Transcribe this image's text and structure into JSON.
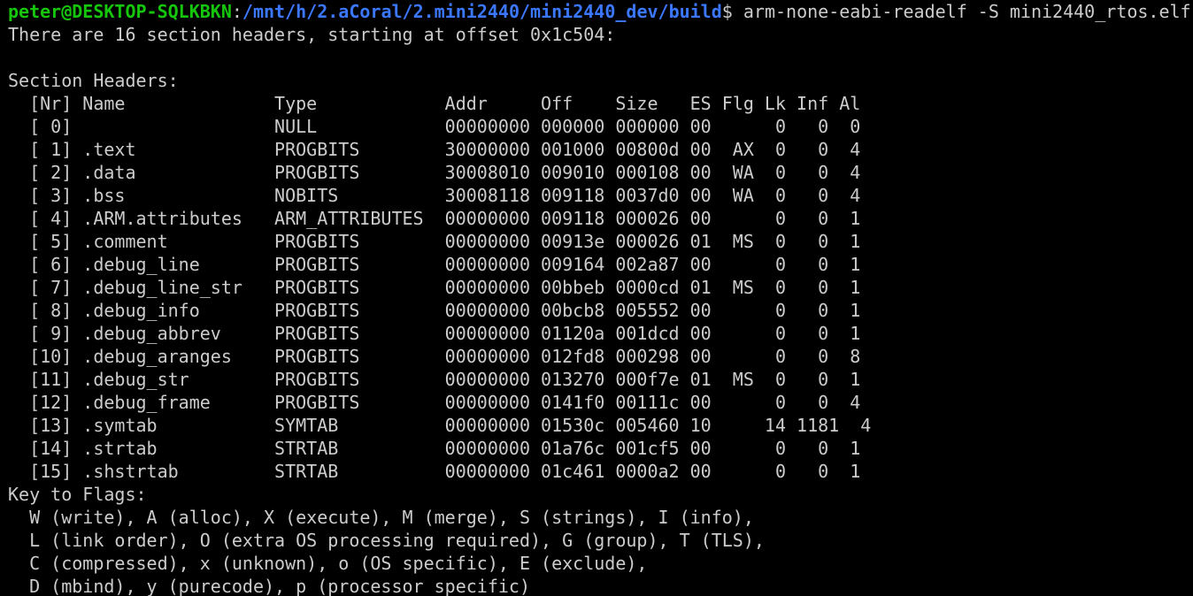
{
  "prompt": {
    "user_host": "peter@DESKTOP-SQLKBKN",
    "separator": ":",
    "path": "/mnt/h/2.aCoral/2.mini2440/mini2440_dev/build",
    "symbol": "$",
    "command": " arm-none-eabi-readelf -S mini2440_rtos.elf"
  },
  "colors": {
    "background": "#000000",
    "text": "#cccccc",
    "prompt_user": "#16c60c",
    "prompt_path": "#3b78ff"
  },
  "output": {
    "summary": "There are 16 section headers, starting at offset 0x1c504:",
    "blank": "",
    "title": "Section Headers:",
    "header": "  [Nr] Name              Type            Addr     Off    Size   ES Flg Lk Inf Al",
    "rows": [
      "  [ 0]                   NULL            00000000 000000 000000 00      0   0  0",
      "  [ 1] .text             PROGBITS        30000000 001000 00800d 00  AX  0   0  4",
      "  [ 2] .data             PROGBITS        30008010 009010 000108 00  WA  0   0  4",
      "  [ 3] .bss              NOBITS          30008118 009118 0037d0 00  WA  0   0  4",
      "  [ 4] .ARM.attributes   ARM_ATTRIBUTES  00000000 009118 000026 00      0   0  1",
      "  [ 5] .comment          PROGBITS        00000000 00913e 000026 01  MS  0   0  1",
      "  [ 6] .debug_line       PROGBITS        00000000 009164 002a87 00      0   0  1",
      "  [ 7] .debug_line_str   PROGBITS        00000000 00bbeb 0000cd 01  MS  0   0  1",
      "  [ 8] .debug_info       PROGBITS        00000000 00bcb8 005552 00      0   0  1",
      "  [ 9] .debug_abbrev     PROGBITS        00000000 01120a 001dcd 00      0   0  1",
      "  [10] .debug_aranges    PROGBITS        00000000 012fd8 000298 00      0   0  8",
      "  [11] .debug_str        PROGBITS        00000000 013270 000f7e 01  MS  0   0  1",
      "  [12] .debug_frame      PROGBITS        00000000 0141f0 00111c 00      0   0  4",
      "  [13] .symtab           SYMTAB          00000000 01530c 005460 10     14 1181  4",
      "  [14] .strtab           STRTAB          00000000 01a76c 001cf5 00      0   0  1",
      "  [15] .shstrtab         STRTAB          00000000 01c461 0000a2 00      0   0  1"
    ],
    "key_title": "Key to Flags:",
    "key_lines": [
      "  W (write), A (alloc), X (execute), M (merge), S (strings), I (info),",
      "  L (link order), O (extra OS processing required), G (group), T (TLS),",
      "  C (compressed), x (unknown), o (OS specific), E (exclude),",
      "  D (mbind), y (purecode), p (processor specific)"
    ]
  }
}
